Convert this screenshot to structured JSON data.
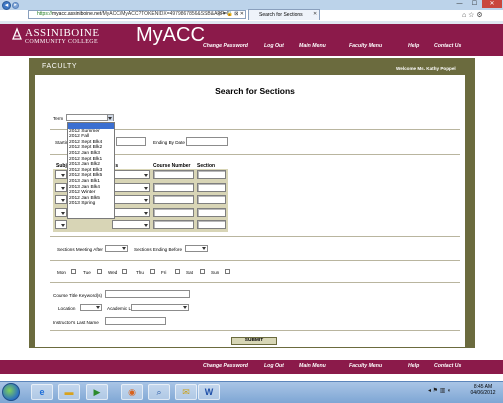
{
  "browser": {
    "url_prefix": "https://",
    "url_host": "myacc.assiniboine.net",
    "url_path": "/MyACC/MyACC?TOKENIDX=4979867856&SSB&APP=F",
    "tab_title": "Search for Sections",
    "addr_icons": "ρ ▾ 🔒 ⊠ ✕",
    "window_min": "—",
    "window_max": "☐",
    "window_close": "✕"
  },
  "header": {
    "college_name": "ASSINIBOINE",
    "college_sub": "COMMUNITY COLLEGE",
    "app_name": "MyACC",
    "nav": [
      "Change Password",
      "Log Out",
      "Main Menu",
      "Faculty Menu",
      "Help",
      "Contact Us"
    ]
  },
  "faculty_bar": {
    "label": "Faculty",
    "welcome": "Welcome Ms. Kathy Poppel"
  },
  "page_title": "Search for Sections",
  "form": {
    "term_label": "Term",
    "term_value": "",
    "term_options": [
      "",
      "2012 Summer",
      "2012 Fall",
      "2012 Sept Blk4",
      "2012 Sept Blk2",
      "2012 Jan Blk3",
      "2012 Sept Blk1",
      "2013 Jan Blk2",
      "2012 Sept Blk3",
      "2012 Sept Blk5",
      "2013 Jan Blk1",
      "2013 Jan Blk4",
      "2012 Winter",
      "2012 Jan Blk5",
      "2013 Spring"
    ],
    "starting_label": "Startin",
    "ending_label": "Ending By Date",
    "grid_subject": "Subj",
    "grid_levels": "ls",
    "grid_course_number": "Course Number",
    "grid_section": "Section",
    "meeting_after_label": "Sections Meeting After",
    "ending_before_label": "Sections Ending Before",
    "days": [
      "Mon",
      "Tue",
      "Wed",
      "Thu",
      "Fri",
      "Sat",
      "Sun"
    ],
    "course_title_label": "Course Title Keyword(s)",
    "location_label": "Location",
    "academic_level_label": "Academic Level",
    "instructor_label": "Instructor's Last Name",
    "submit_label": "SUBMIT"
  },
  "taskbar": {
    "time": "8:45 AM",
    "date": "04/06/2012",
    "tray": "◂ ⚑ ▥ ◖"
  },
  "colors": {
    "brand": "#8b1a4a",
    "olive": "#6b6b3e",
    "grid_bg": "#d8d5b6"
  }
}
